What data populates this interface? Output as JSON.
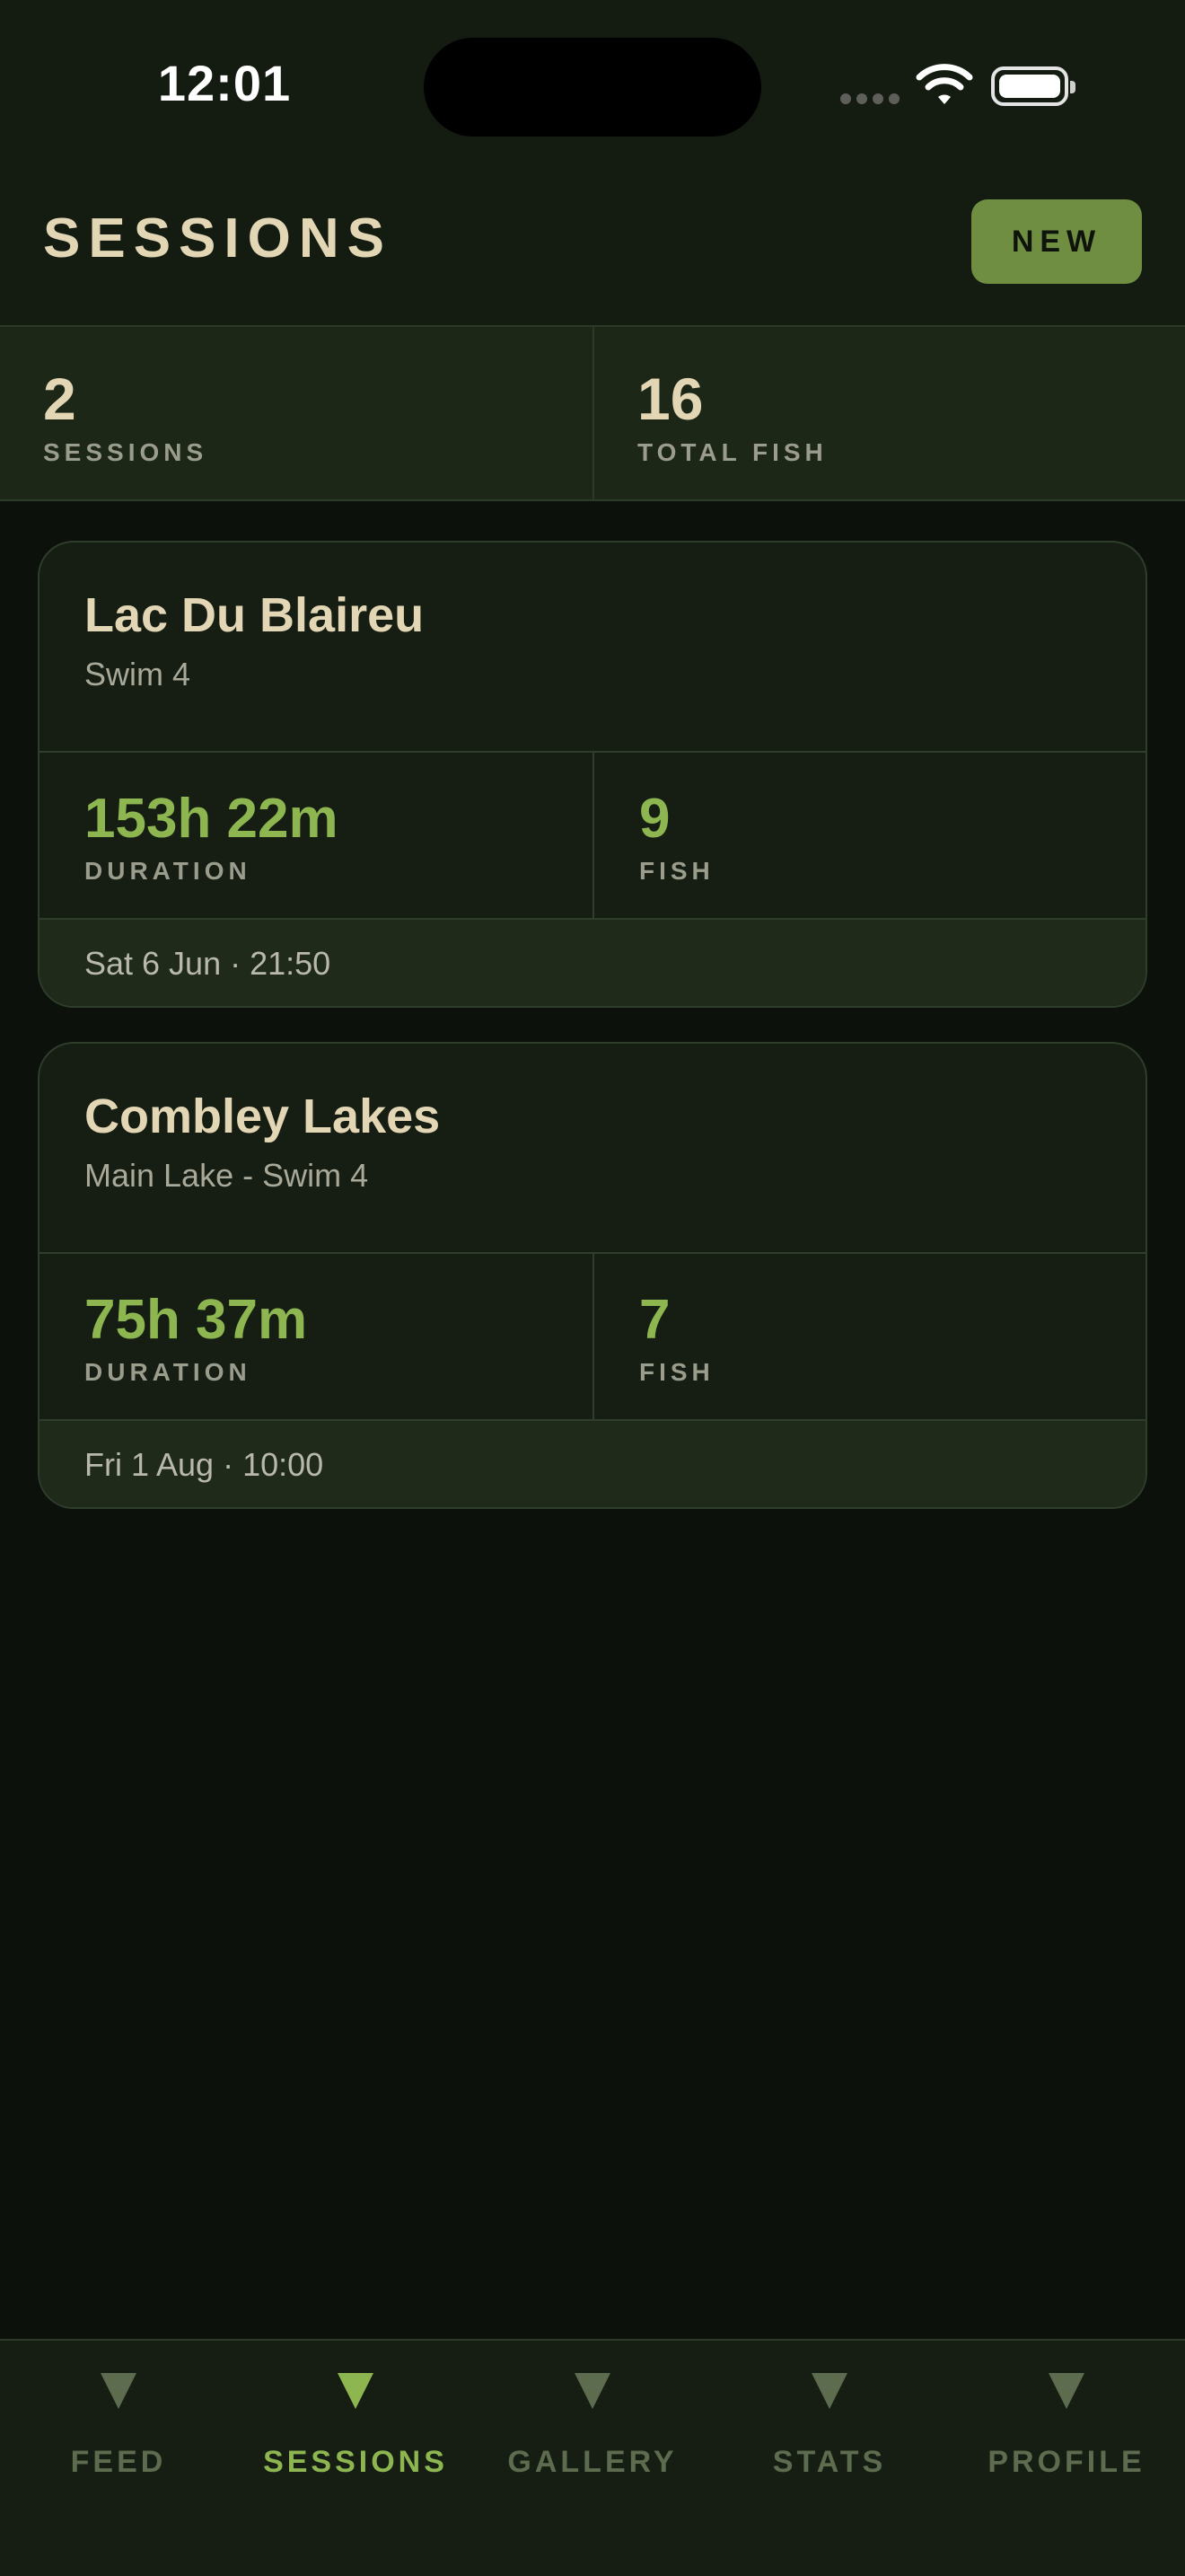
{
  "status_bar": {
    "time": "12:01"
  },
  "header": {
    "title": "SESSIONS",
    "new_label": "NEW"
  },
  "summary": {
    "sessions_value": "2",
    "sessions_label": "SESSIONS",
    "total_fish_value": "16",
    "total_fish_label": "TOTAL FISH"
  },
  "sessions": [
    {
      "venue": "Lac Du Blaireu",
      "swim": "Swim 4",
      "duration": "153h 22m",
      "duration_label": "DURATION",
      "fish": "9",
      "fish_label": "FISH",
      "started": "Sat 6 Jun · 21:50"
    },
    {
      "venue": "Combley Lakes",
      "swim": "Main Lake - Swim 4",
      "duration": "75h 37m",
      "duration_label": "DURATION",
      "fish": "7",
      "fish_label": "FISH",
      "started": "Fri 1 Aug · 10:00"
    }
  ],
  "tabs": [
    {
      "label": "FEED",
      "icon": "triangle-down-icon"
    },
    {
      "label": "SESSIONS",
      "icon": "triangle-down-icon",
      "active": true
    },
    {
      "label": "GALLERY",
      "icon": "triangle-down-icon"
    },
    {
      "label": "STATS",
      "icon": "triangle-down-icon"
    },
    {
      "label": "PROFILE",
      "icon": "triangle-down-icon"
    }
  ],
  "colors": {
    "accent": "#8db650",
    "button": "#6f8e42",
    "title": "#e2d6b5",
    "background": "#0c120b"
  }
}
